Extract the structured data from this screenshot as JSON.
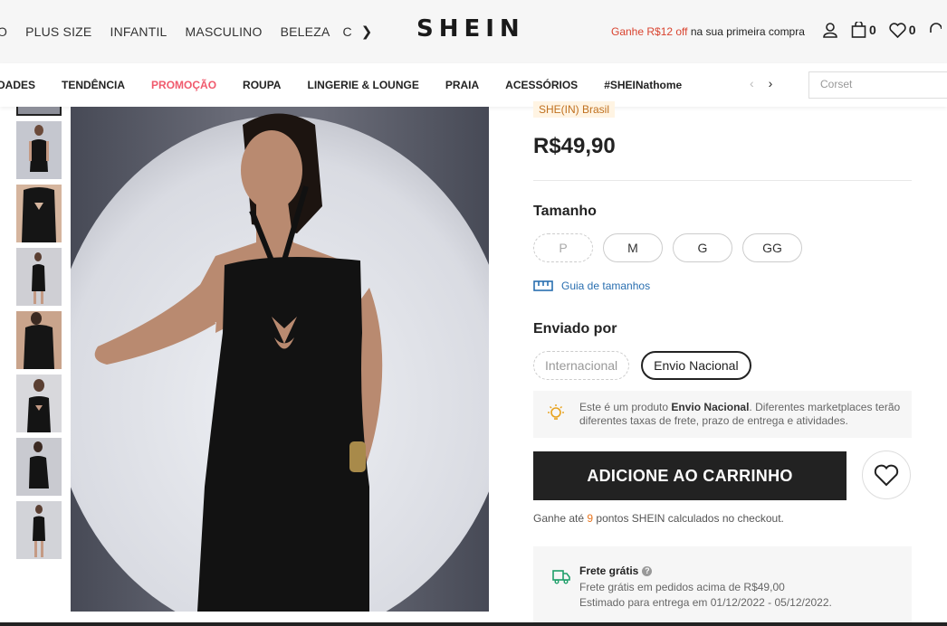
{
  "header": {
    "categories": [
      "O",
      "PLUS SIZE",
      "INFANTIL",
      "MASCULINO",
      "BELEZA",
      "C"
    ],
    "logo": "SHEIN",
    "promo_highlight": "Ganhe R$12 off",
    "promo_rest": " na sua primeira compra",
    "cart_count": "0",
    "wishlist_count": "0"
  },
  "subnav": {
    "items": [
      "DADES",
      "TENDÊNCIA",
      "PROMOÇÃO",
      "ROUPA",
      "LINGERIE & LOUNGE",
      "PRAIA",
      "ACESSÓRIOS",
      "#SHEINathome"
    ],
    "search_placeholder": "Corset"
  },
  "product": {
    "store_tag": "SHE(IN) Brasil",
    "price": "R$49,90",
    "size_label": "Tamanho",
    "sizes": [
      "P",
      "M",
      "G",
      "GG"
    ],
    "size_guide": "Guia de tamanhos",
    "shipped_by_label": "Enviado por",
    "shipping_options": [
      "Internacional",
      "Envio Nacional"
    ],
    "notice_pre": "Este é um produto ",
    "notice_bold": "Envio Nacional",
    "notice_post": ". Diferentes marketplaces terão diferentes taxas de frete, prazo de entrega e atividades.",
    "add_to_cart": "ADICIONE AO CARRINHO",
    "points_pre": "Ganhe até ",
    "points_value": "9",
    "points_post": " pontos SHEIN calculados no checkout.",
    "free_ship_title": "Frete grátis",
    "free_ship_line1": "Frete grátis em pedidos acima de R$49,00",
    "free_ship_line2": "Estimado para entrega em 01/12/2022 - 05/12/2022."
  },
  "colors": {
    "accent_pink": "#f05a6d",
    "promo_red": "#d9432f",
    "points_orange": "#e8731c",
    "link_blue": "#2a6fb0"
  }
}
